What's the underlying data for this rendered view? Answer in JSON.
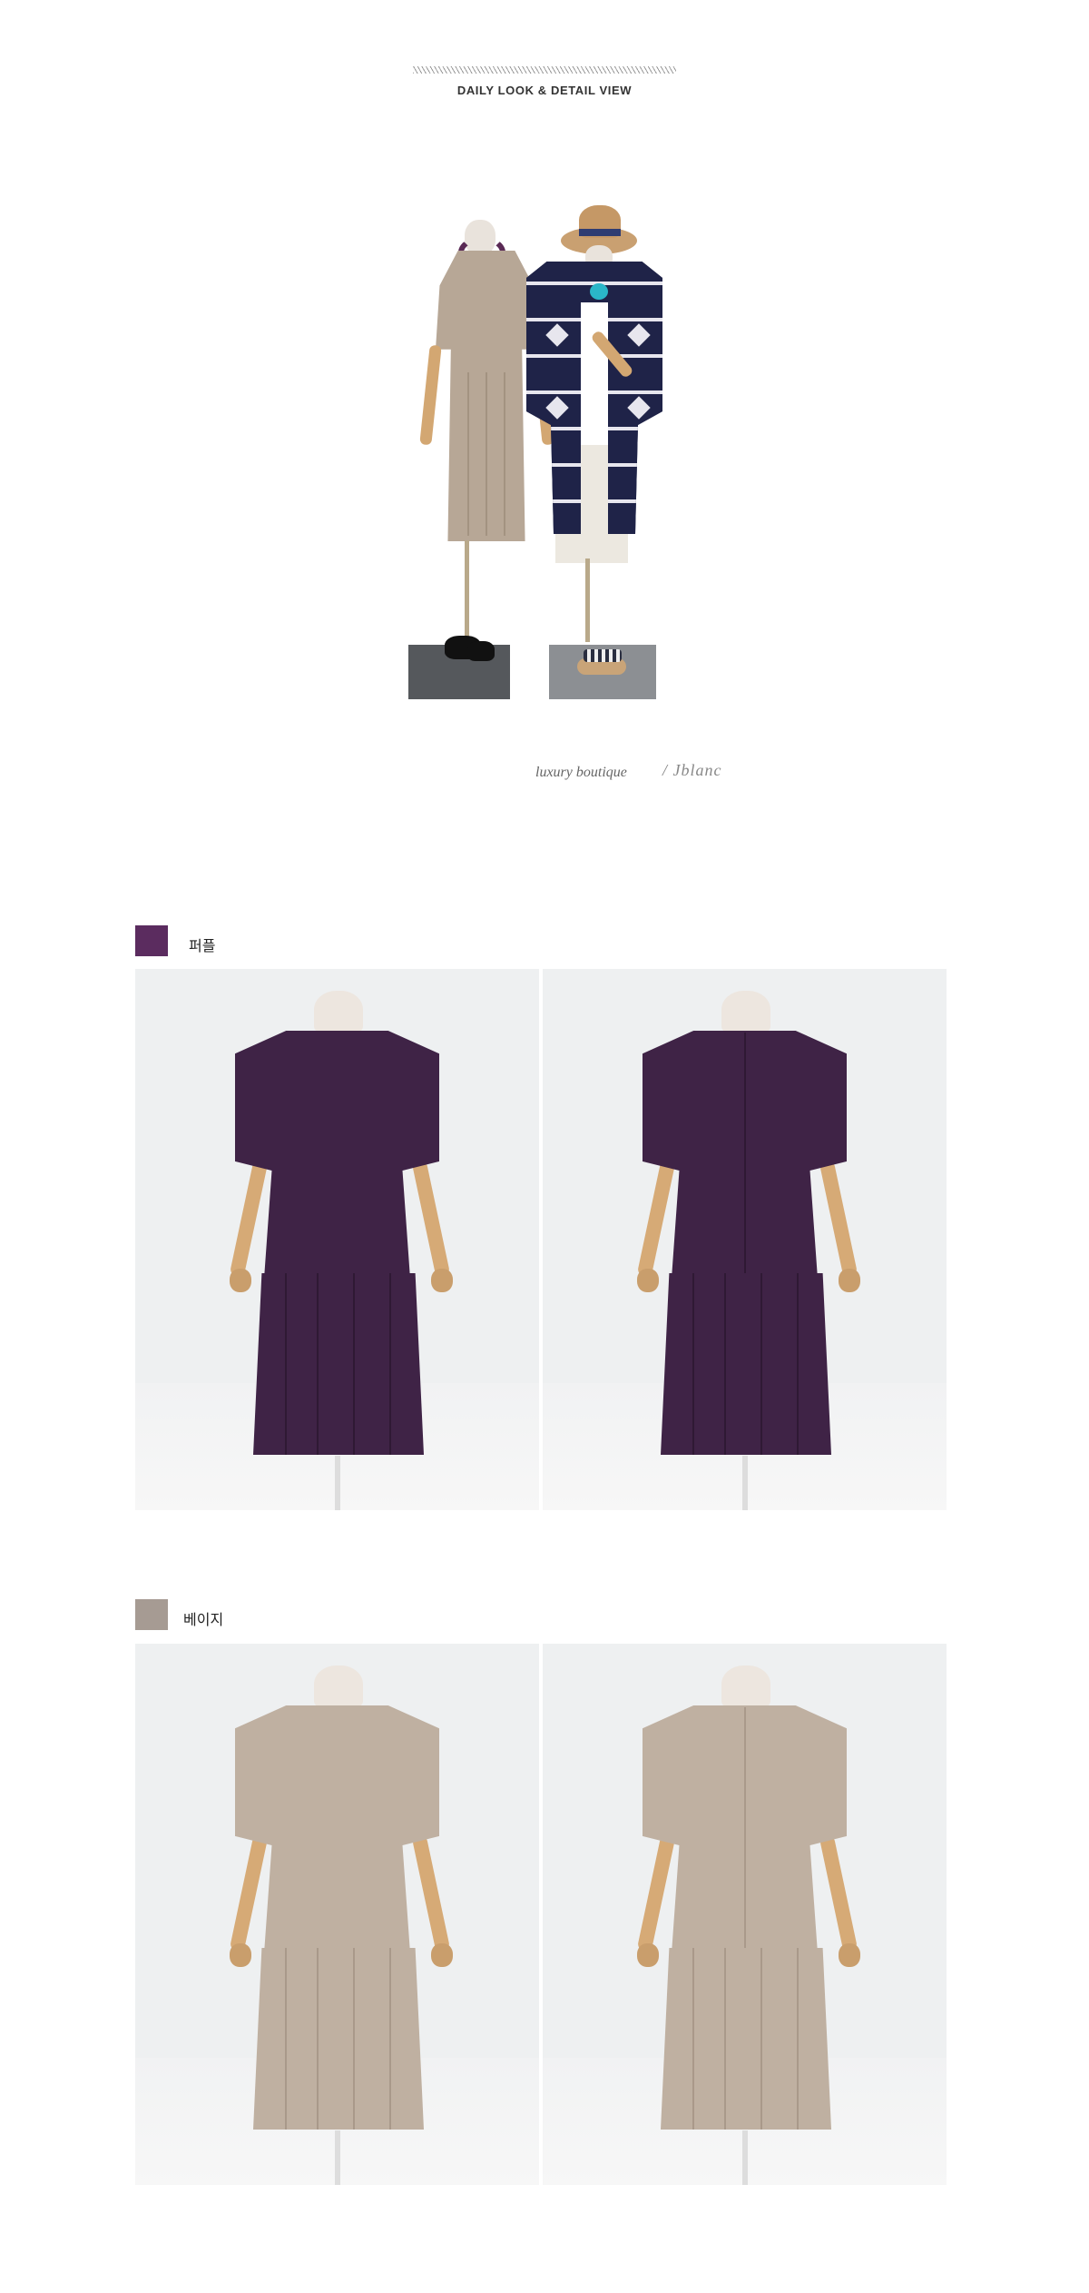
{
  "header": {
    "section_title": "DAILY LOOK & DETAIL VIEW"
  },
  "brand": {
    "tagline": "luxury boutique",
    "signature": "/ Jblanc"
  },
  "colors": [
    {
      "label": "퍼플",
      "swatch": "#5b2c5f",
      "dress_color": "#3f2346",
      "pleat_color": "#2f1934",
      "views": [
        "front",
        "back"
      ]
    },
    {
      "label": "베이지",
      "swatch": "#a69b93",
      "dress_color": "#bfb0a1",
      "pleat_color": "#a9998a",
      "views": [
        "front",
        "back"
      ]
    }
  ]
}
